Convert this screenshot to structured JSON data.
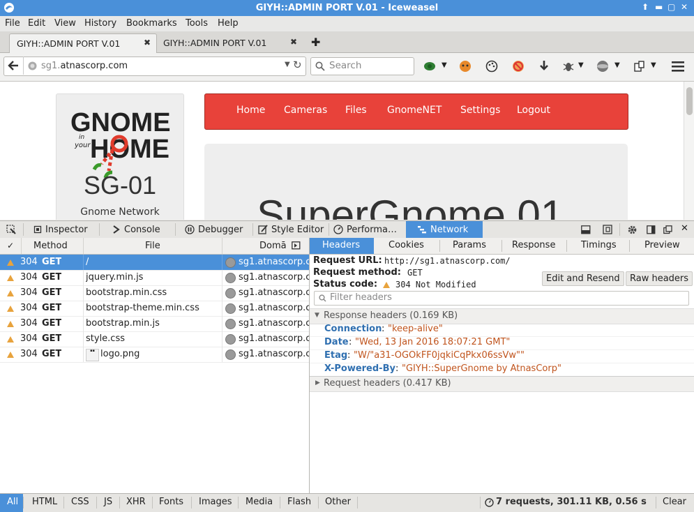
{
  "window": {
    "title": "GIYH::ADMIN PORT V.01 - Iceweasel"
  },
  "menu": [
    "File",
    "Edit",
    "View",
    "History",
    "Bookmarks",
    "Tools",
    "Help"
  ],
  "tabs": [
    {
      "label": "GIYH::ADMIN PORT V.01",
      "active": true
    },
    {
      "label": "GIYH::ADMIN PORT V.01",
      "active": false
    }
  ],
  "navbar": {
    "url_gray": "sg1.",
    "url_main": "atnascorp.com",
    "search_placeholder": "Search"
  },
  "page": {
    "logo_line1": "GNOME",
    "logo_in": "in",
    "logo_your": "your",
    "logo_line2": "HOME",
    "device_title": "SG-01",
    "device_subtitle": "Gnome Network",
    "nav": [
      "Home",
      "Cameras",
      "Files",
      "GnomeNET",
      "Settings",
      "Logout"
    ],
    "hero_title": "SuperGnome 01",
    "colors": {
      "nav_red": "#e8423a",
      "logo_red": "#e03b2c",
      "logo_green": "#3a9a2a"
    }
  },
  "devtools": {
    "tabs": [
      "Inspector",
      "Console",
      "Debugger",
      "Style Editor",
      "Performa…",
      "Network"
    ],
    "active_tab": "Network"
  },
  "network": {
    "columns": {
      "check": "✓",
      "method": "Method",
      "file": "File",
      "domain": "Domā"
    },
    "rows": [
      {
        "status": "304",
        "method": "GET",
        "file": "/",
        "domain": "sg1.atnascorp.c",
        "selected": true
      },
      {
        "status": "304",
        "method": "GET",
        "file": "jquery.min.js",
        "domain": "sg1.atnascorp.c",
        "selected": false
      },
      {
        "status": "304",
        "method": "GET",
        "file": "bootstrap.min.css",
        "domain": "sg1.atnascorp.c",
        "selected": false
      },
      {
        "status": "304",
        "method": "GET",
        "file": "bootstrap-theme.min.css",
        "domain": "sg1.atnascorp.c",
        "selected": false
      },
      {
        "status": "304",
        "method": "GET",
        "file": "bootstrap.min.js",
        "domain": "sg1.atnascorp.c",
        "selected": false
      },
      {
        "status": "304",
        "method": "GET",
        "file": "style.css",
        "domain": "sg1.atnascorp.c",
        "selected": false
      },
      {
        "status": "304",
        "method": "GET",
        "file": "logo.png",
        "domain": "sg1.atnascorp.c",
        "selected": false
      }
    ]
  },
  "detail": {
    "tabs": [
      "Headers",
      "Cookies",
      "Params",
      "Response",
      "Timings",
      "Preview"
    ],
    "active_tab": "Headers",
    "request_url_label": "Request URL:",
    "request_url": "http://sg1.atnascorp.com/",
    "request_method_label": "Request method:",
    "request_method": "GET",
    "status_code_label": "Status code:",
    "status_code": "304 Not Modified",
    "edit_resend": "Edit and Resend",
    "raw_headers": "Raw headers",
    "filter_placeholder": "Filter headers",
    "response_headers_title": "Response headers (0.169 KB)",
    "response_headers": [
      {
        "key": "Connection",
        "value": "\"keep-alive\""
      },
      {
        "key": "Date",
        "value": "\"Wed, 13 Jan 2016 18:07:21 GMT\""
      },
      {
        "key": "Etag",
        "value": "\"W/\"a31-OGOkFF0jqkiCqPkx06ssVw\"\""
      },
      {
        "key": "X-Powered-By",
        "value": "\"GIYH::SuperGnome by AtnasCorp\""
      }
    ],
    "request_headers_title": "Request headers (0.417 KB)"
  },
  "footer": {
    "filters": [
      "All",
      "HTML",
      "CSS",
      "JS",
      "XHR",
      "Fonts",
      "Images",
      "Media",
      "Flash",
      "Other"
    ],
    "active_filter": "All",
    "summary": "7 requests, 301.11 KB, 0.56 s",
    "clear": "Clear"
  }
}
